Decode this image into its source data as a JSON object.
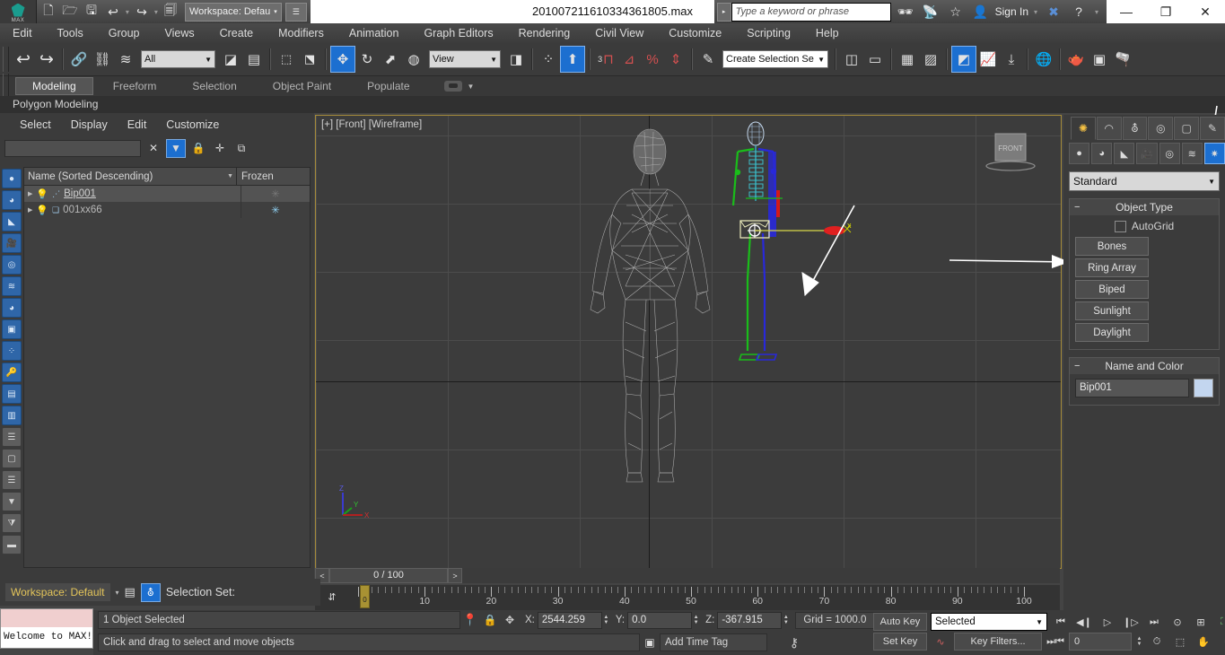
{
  "titlebar": {
    "app_logo": "max-logo",
    "workspace_label": "Workspace: Defau",
    "file_title": "201007211610334361805.max",
    "search_placeholder": "Type a keyword or phrase",
    "signin_label": "Sign In",
    "icons": [
      "new-file-icon",
      "open-file-icon",
      "save-icon",
      "undo-icon",
      "redo-icon",
      "set-project-icon"
    ],
    "right_icons": [
      "binoculars-icon",
      "satellite-icon",
      "star-icon",
      "user-icon",
      "exchange-icon",
      "help-icon"
    ],
    "window_controls": [
      "minimize",
      "restore",
      "close"
    ]
  },
  "menubar": {
    "items": [
      "Edit",
      "Tools",
      "Group",
      "Views",
      "Create",
      "Modifiers",
      "Animation",
      "Graph Editors",
      "Rendering",
      "Civil View",
      "Customize",
      "Scripting",
      "Help"
    ]
  },
  "maintoolbar": {
    "selection_filter": "All",
    "reference_coord": "View",
    "selection_set": "Create Selection Se",
    "snap_percent_label": "%",
    "snap_count_label": "3",
    "icons": [
      "undo-icon",
      "redo-icon",
      "select-link-icon",
      "unlink-icon",
      "bind-space-warp-icon",
      "select-object-icon",
      "select-by-name-icon",
      "rectangle-select-icon",
      "window-crossing-icon",
      "select-move-icon",
      "select-rotate-icon",
      "select-scale-icon",
      "use-center-icon",
      "mirror-icon",
      "align-icon",
      "snap-toggle-icon",
      "angle-snap-icon",
      "percent-snap-icon",
      "spinner-snap-icon",
      "named-selection-icon",
      "curve-editor-icon",
      "schematic-view-icon",
      "material-editor-icon",
      "render-setup-icon",
      "rendered-frame-icon",
      "render-production-icon"
    ]
  },
  "ribbon": {
    "tabs": [
      "Modeling",
      "Freeform",
      "Selection",
      "Object Paint",
      "Populate"
    ],
    "active_tab": "Modeling",
    "subtab": "Polygon Modeling"
  },
  "scene_explorer": {
    "menu": [
      "Select",
      "Display",
      "Edit",
      "Customize"
    ],
    "search_value": "",
    "toolbar_icons": [
      "clear-icon",
      "filter-icon",
      "lock-icon",
      "add-icon",
      "sync-icon"
    ],
    "columns": [
      "Name (Sorted Descending)",
      "Frozen"
    ],
    "rows": [
      {
        "name": "Bip001",
        "frozen": "",
        "selected": true,
        "icon": "bone-icon"
      },
      {
        "name": "001xx66",
        "frozen": "*",
        "selected": false,
        "icon": "mesh-icon"
      }
    ],
    "vertical_tools": [
      "sphere-icon",
      "material-icon",
      "light-icon",
      "camera-icon",
      "render-icon",
      "wave-icon",
      "layer-icon",
      "frame-icon",
      "link-icon",
      "key-icon",
      "script-icon",
      "display-icon",
      "list-icon",
      "panel-icon",
      "rows-icon",
      "filter-funnel-icon",
      "filter-config-icon",
      "batch-icon"
    ]
  },
  "viewport": {
    "label": "[+] [Front] [Wireframe]",
    "viewcube_label": "FRONT",
    "axis_gizmo_x": "x",
    "axis_tripod": [
      "Z",
      "Y",
      "X"
    ]
  },
  "command_panel": {
    "tabs": [
      "create-tab",
      "modify-tab",
      "hierarchy-tab",
      "motion-tab",
      "display-tab",
      "utilities-tab"
    ],
    "active_tab": "create-tab",
    "categories": [
      "geometry-icon",
      "shapes-icon",
      "lights-icon",
      "cameras-icon",
      "helpers-icon",
      "space-warps-icon",
      "systems-icon"
    ],
    "active_category": "systems-icon",
    "subcategory": "Standard",
    "object_type": {
      "title": "Object Type",
      "autogrid_label": "AutoGrid",
      "autogrid_checked": false,
      "buttons": [
        "Bones",
        "Ring Array",
        "Biped",
        "Sunlight",
        "Daylight"
      ]
    },
    "name_and_color": {
      "title": "Name and Color",
      "name": "Bip001",
      "color": "#c3d6ef"
    }
  },
  "timeline": {
    "current_frame_label": "0 / 100",
    "prev_button": "<",
    "next_button": ">",
    "start": 0,
    "end": 100,
    "tick_labels": [
      10,
      20,
      30,
      40,
      50,
      60,
      70,
      80,
      90,
      100
    ],
    "handle_label": "0"
  },
  "statusbar": {
    "workspace": "Workspace: Default",
    "selection_set_label": "Selection Set:",
    "selection_set_value": "",
    "message": "1 Object Selected",
    "prompt": "Click and drag to select and move objects",
    "welcome_text": "Welcome to MAX!",
    "add_time_tag": "Add Time Tag",
    "coords": {
      "x_label": "X:",
      "x": "2544.259",
      "y_label": "Y:",
      "y": "0.0",
      "z_label": "Z:",
      "z": "-367.915"
    },
    "grid": "Grid = 1000.0",
    "auto_key": "Auto Key",
    "set_key": "Set Key",
    "key_mode": "Selected",
    "key_filters": "Key Filters...",
    "key_frame_value": "0",
    "nav_icons": [
      "zoom-icon",
      "zoom-all-icon",
      "zoom-extents-icon",
      "field-of-view-icon",
      "pan-icon",
      "orbit-icon",
      "maximize-viewport-icon"
    ]
  },
  "colors": {
    "accent_blue": "#1c6fd0",
    "panel_bg": "#3b3b3b",
    "viewport_bg": "#3c3c3c",
    "viewport_border": "#a58b3a",
    "workspace_yellow": "#e3c45a",
    "biped_green": "#19b219",
    "biped_blue": "#2020d8",
    "gizmo_red": "#d81818"
  }
}
